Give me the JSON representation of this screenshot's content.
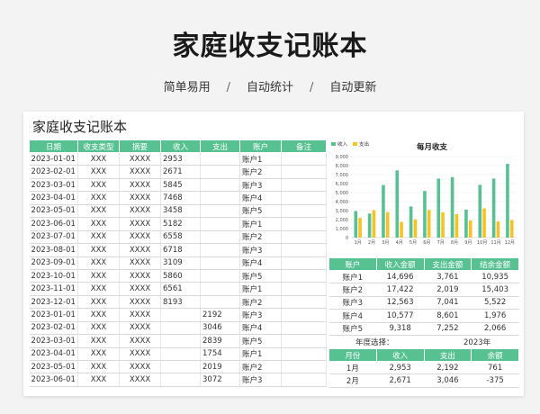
{
  "page": {
    "title": "家庭收支记账本",
    "tags": [
      "简单易用",
      "自动统计",
      "自动更新"
    ],
    "sep": "/"
  },
  "sheet": {
    "title": "家庭收支记账本",
    "headers": [
      "日期",
      "收支类型",
      "摘要",
      "收入",
      "支出",
      "账户",
      "备注"
    ],
    "rows": [
      [
        "2023-01-01",
        "XXX",
        "XXXX",
        "2953",
        "",
        "账户1",
        ""
      ],
      [
        "2023-02-01",
        "XXX",
        "XXXX",
        "2671",
        "",
        "账户2",
        ""
      ],
      [
        "2023-03-01",
        "XXX",
        "XXXX",
        "5845",
        "",
        "账户3",
        ""
      ],
      [
        "2023-04-01",
        "XXX",
        "XXXX",
        "7468",
        "",
        "账户4",
        ""
      ],
      [
        "2023-05-01",
        "XXX",
        "XXXX",
        "3458",
        "",
        "账户5",
        ""
      ],
      [
        "2023-06-01",
        "XXX",
        "XXXX",
        "5182",
        "",
        "账户1",
        ""
      ],
      [
        "2023-07-01",
        "XXX",
        "XXXX",
        "6558",
        "",
        "账户2",
        ""
      ],
      [
        "2023-08-01",
        "XXX",
        "XXXX",
        "6718",
        "",
        "账户3",
        ""
      ],
      [
        "2023-09-01",
        "XXX",
        "XXXX",
        "3109",
        "",
        "账户4",
        ""
      ],
      [
        "2023-10-01",
        "XXX",
        "XXXX",
        "5860",
        "",
        "账户5",
        ""
      ],
      [
        "2023-11-01",
        "XXX",
        "XXXX",
        "6561",
        "",
        "账户1",
        ""
      ],
      [
        "2023-12-01",
        "XXX",
        "XXXX",
        "8193",
        "",
        "账户2",
        ""
      ],
      [
        "2023-01-01",
        "XXX",
        "XXXX",
        "",
        "2192",
        "账户3",
        ""
      ],
      [
        "2023-02-01",
        "XXX",
        "XXXX",
        "",
        "3046",
        "账户4",
        ""
      ],
      [
        "2023-03-01",
        "XXX",
        "XXXX",
        "",
        "2839",
        "账户5",
        ""
      ],
      [
        "2023-04-01",
        "XXX",
        "XXXX",
        "",
        "1754",
        "账户1",
        ""
      ],
      [
        "2023-05-01",
        "XXX",
        "XXXX",
        "",
        "2019",
        "账户2",
        ""
      ],
      [
        "2023-06-01",
        "XXX",
        "XXXX",
        "",
        "3072",
        "账户3",
        ""
      ]
    ]
  },
  "summary": {
    "headers": [
      "账户",
      "收入金额",
      "支出金额",
      "结余金额"
    ],
    "rows": [
      [
        "账户1",
        "14,696",
        "3,761",
        "10,935"
      ],
      [
        "账户2",
        "17,422",
        "2,019",
        "15,403"
      ],
      [
        "账户3",
        "12,563",
        "7,041",
        "5,522"
      ],
      [
        "账户4",
        "10,577",
        "8,601",
        "1,976"
      ],
      [
        "账户5",
        "9,318",
        "7,252",
        "2,066"
      ]
    ]
  },
  "year_select": {
    "label": "年度选择：",
    "value": "2023年"
  },
  "monthly": {
    "headers": [
      "月份",
      "收入",
      "支出",
      "余额"
    ],
    "rows": [
      [
        "1月",
        "2,953",
        "2,192",
        "761"
      ],
      [
        "2月",
        "2,671",
        "3,046",
        "-375"
      ]
    ]
  },
  "chart_data": {
    "type": "bar",
    "title": "每月收支",
    "categories": [
      "1月",
      "2月",
      "3月",
      "4月",
      "5月",
      "6月",
      "7月",
      "8月",
      "9月",
      "10月",
      "11月",
      "12月"
    ],
    "series": [
      {
        "name": "收入",
        "color": "#57c191",
        "values": [
          2953,
          2671,
          5845,
          7468,
          3458,
          5182,
          6558,
          6718,
          3109,
          5860,
          6561,
          8193
        ]
      },
      {
        "name": "支出",
        "color": "#f5c322",
        "values": [
          2192,
          3046,
          2839,
          1754,
          2019,
          3072,
          2800,
          2600,
          1900,
          3250,
          1800,
          1950
        ]
      }
    ],
    "yticks": [
      "0",
      "1,000",
      "2,000",
      "3,000",
      "4,000",
      "5,000",
      "6,000",
      "7,000",
      "8,000",
      "9,000"
    ],
    "ylim": [
      0,
      9000
    ],
    "legend": "top-left",
    "grid": true
  }
}
